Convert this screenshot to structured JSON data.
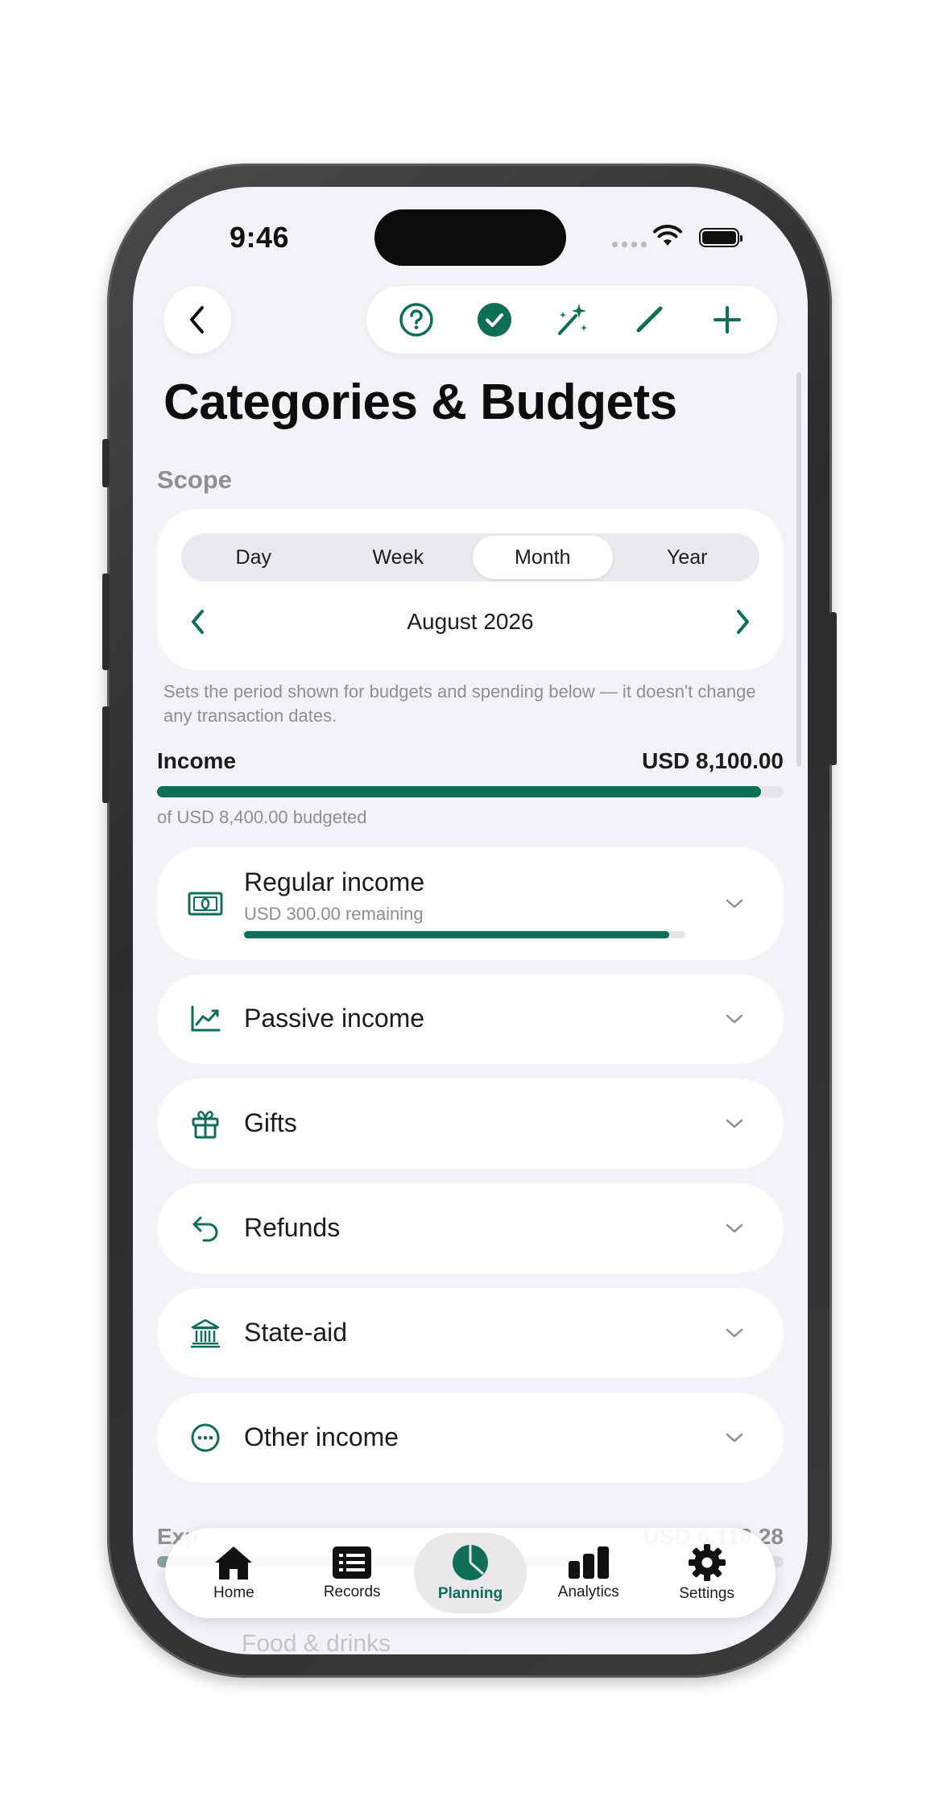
{
  "status_bar": {
    "time": "9:46"
  },
  "toolbar": {
    "back_icon": "chevron-left-icon",
    "actions": [
      "help-icon",
      "checkmark-icon",
      "magic-wand-icon",
      "pencil-icon",
      "plus-icon"
    ]
  },
  "page": {
    "title": "Categories & Budgets"
  },
  "scope": {
    "label": "Scope",
    "segments": [
      "Day",
      "Week",
      "Month",
      "Year"
    ],
    "selected": "Month",
    "period": "August 2026",
    "hint": "Sets the period shown for budgets and spending below — it doesn't change any transaction dates."
  },
  "income": {
    "label": "Income",
    "amount": "USD 8,100.00",
    "budgeted": "of USD 8,400.00 budgeted",
    "progress_percent": 96.4
  },
  "categories": [
    {
      "name": "Regular income",
      "subtitle": "USD 300.00 remaining",
      "progress_percent": 96.4,
      "icon": "banknote-icon"
    },
    {
      "name": "Passive income",
      "icon": "trend-chart-icon"
    },
    {
      "name": "Gifts",
      "icon": "gift-icon"
    },
    {
      "name": "Refunds",
      "icon": "return-arrow-icon"
    },
    {
      "name": "State-aid",
      "icon": "bank-building-icon"
    },
    {
      "name": "Other income",
      "icon": "ellipsis-circle-icon"
    }
  ],
  "expenses_partial": {
    "label": "Exp",
    "amount": "USD 6,110.28",
    "next_item": "Food & drinks"
  },
  "tab_bar": {
    "tabs": [
      {
        "label": "Home",
        "icon": "house-icon"
      },
      {
        "label": "Records",
        "icon": "list-icon"
      },
      {
        "label": "Planning",
        "icon": "pie-chart-icon"
      },
      {
        "label": "Analytics",
        "icon": "bar-chart-icon"
      },
      {
        "label": "Settings",
        "icon": "gear-icon"
      }
    ],
    "active": "Planning"
  },
  "colors": {
    "accent": "#0f6e56",
    "background": "#f2f2f7",
    "card": "#ffffff"
  }
}
